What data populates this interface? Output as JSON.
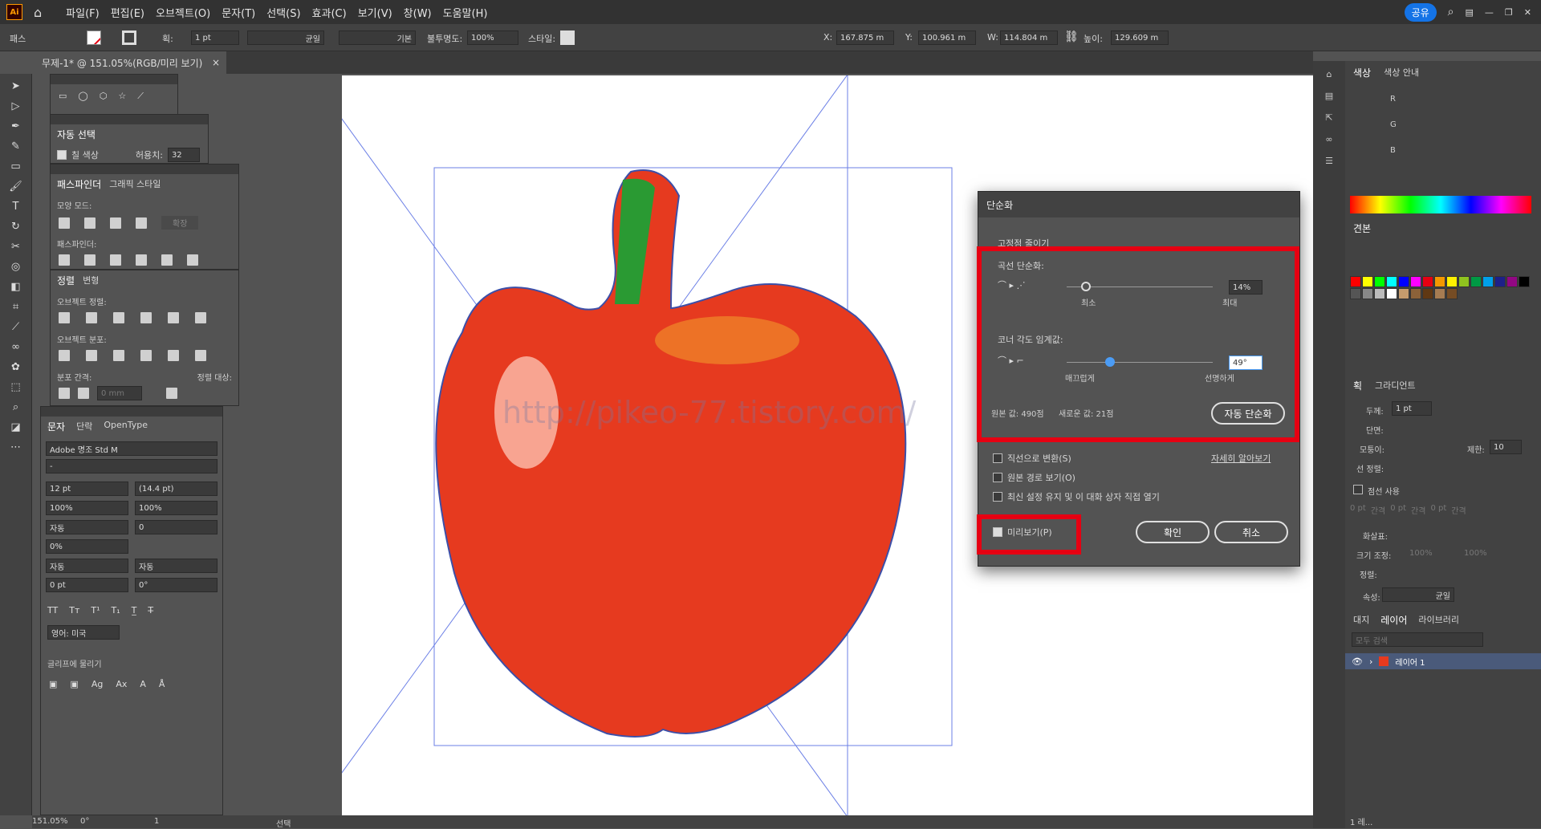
{
  "menubar": {
    "logo": "Ai",
    "items": [
      "파일(F)",
      "편집(E)",
      "오브젝트(O)",
      "문자(T)",
      "선택(S)",
      "효과(C)",
      "보기(V)",
      "창(W)",
      "도움말(H)"
    ],
    "share": "공유"
  },
  "control": {
    "path_label": "패스",
    "stroke_label": "획:",
    "stroke_value": "1 pt",
    "profile": "균일",
    "brush": "기본",
    "opacity_label": "불투명도:",
    "opacity": "100%",
    "style_label": "스타일:",
    "x_label": "X:",
    "x": "167.875 m",
    "y_label": "Y:",
    "y": "100.961 m",
    "w_label": "W:",
    "w": "114.804 m",
    "h_label": "높이:",
    "h": "129.609 m"
  },
  "doc_tab": {
    "title": "무제-1* @ 151.05%(RGB/미리 보기)",
    "close": "×"
  },
  "autoselect": {
    "title": "자동 선택",
    "fill_label": "칠 색상",
    "tol_label": "허용치:",
    "tol": "32"
  },
  "pathfinder": {
    "tab1": "패스파인더",
    "tab2": "그래픽 스타일",
    "shape_mode": "모양 모드:",
    "expand": "확장",
    "pathfinders": "패스파인더:"
  },
  "align": {
    "tab1": "정렬",
    "tab2": "변형",
    "obj_align": "오브젝트 정렬:",
    "obj_dist": "오브젝트 분포:",
    "dist_spacing": "분포 간격:",
    "align_to": "정렬 대상:",
    "spacing": "0 mm"
  },
  "char": {
    "tab1": "문자",
    "tab2": "단락",
    "tab3": "OpenType",
    "font": "Adobe 명조 Std M",
    "style": "-",
    "size": "12 pt",
    "leading": "(14.4 pt)",
    "hscale": "100%",
    "vscale": "100%",
    "kern": "자동",
    "track": "0",
    "tsume": "0%",
    "aki1": "자동",
    "aki2": "자동",
    "baseline": "0 pt",
    "rotate": "0°",
    "lang": "영어: 미국",
    "snap": "글리프에 물리기"
  },
  "dialog": {
    "title": "단순화",
    "reduce": "고정점 줄이기",
    "curve_label": "곡선 단순화:",
    "curve_value": "14%",
    "min": "최소",
    "max": "최대",
    "corner_label": "코너 각도 임계값:",
    "corner_value": "49°",
    "smooth": "매끄럽게",
    "sharp": "선명하게",
    "orig": "원본 값: 490점",
    "new": "새로운 값: 21점",
    "auto": "자동 단순화",
    "opt1": "직선으로 변환(S)",
    "opt2": "원본 경로 보기(O)",
    "opt3": "최신 설정 유지 및 이 대화 상자 직접 열기",
    "learn": "자세히 알아보기",
    "preview": "미리보기(P)",
    "ok": "확인",
    "cancel": "취소"
  },
  "right": {
    "color_tab": "색상",
    "color_guide": "색상 안내",
    "r": "R",
    "g": "G",
    "b": "B",
    "swatch_tab": "견본",
    "stroke_tab": "획",
    "gradient_tab": "그라디언트",
    "weight_label": "두께:",
    "weight": "1 pt",
    "cap_label": "단면:",
    "corner_label": "모퉁이:",
    "limit_label": "제한:",
    "limit": "10",
    "align_stroke": "선 정렬:",
    "dash": "점선 사용",
    "dash_cells": [
      "0 pt",
      "간격",
      "0 pt",
      "간격",
      "0 pt",
      "간격"
    ],
    "arrow": "화살표:",
    "scale": "크기 조정:",
    "scale1": "100%",
    "scale2": "100%",
    "align2": "정렬:",
    "profile_label": "속성:",
    "profile": "균일",
    "layers_tabs": [
      "대지",
      "레이어",
      "라이브러리"
    ],
    "search": "모두 검색",
    "layer1": "레이어 1",
    "layers_count": "1 레..."
  },
  "status": {
    "zoom": "151.05%",
    "angle": "0°",
    "page": "1",
    "mode": "선택"
  },
  "watermark": "http://pikeo-77.tistory.com/",
  "colors": {
    "red": "#e60012",
    "accent": "#4b9cf5",
    "ui": "#535353"
  }
}
